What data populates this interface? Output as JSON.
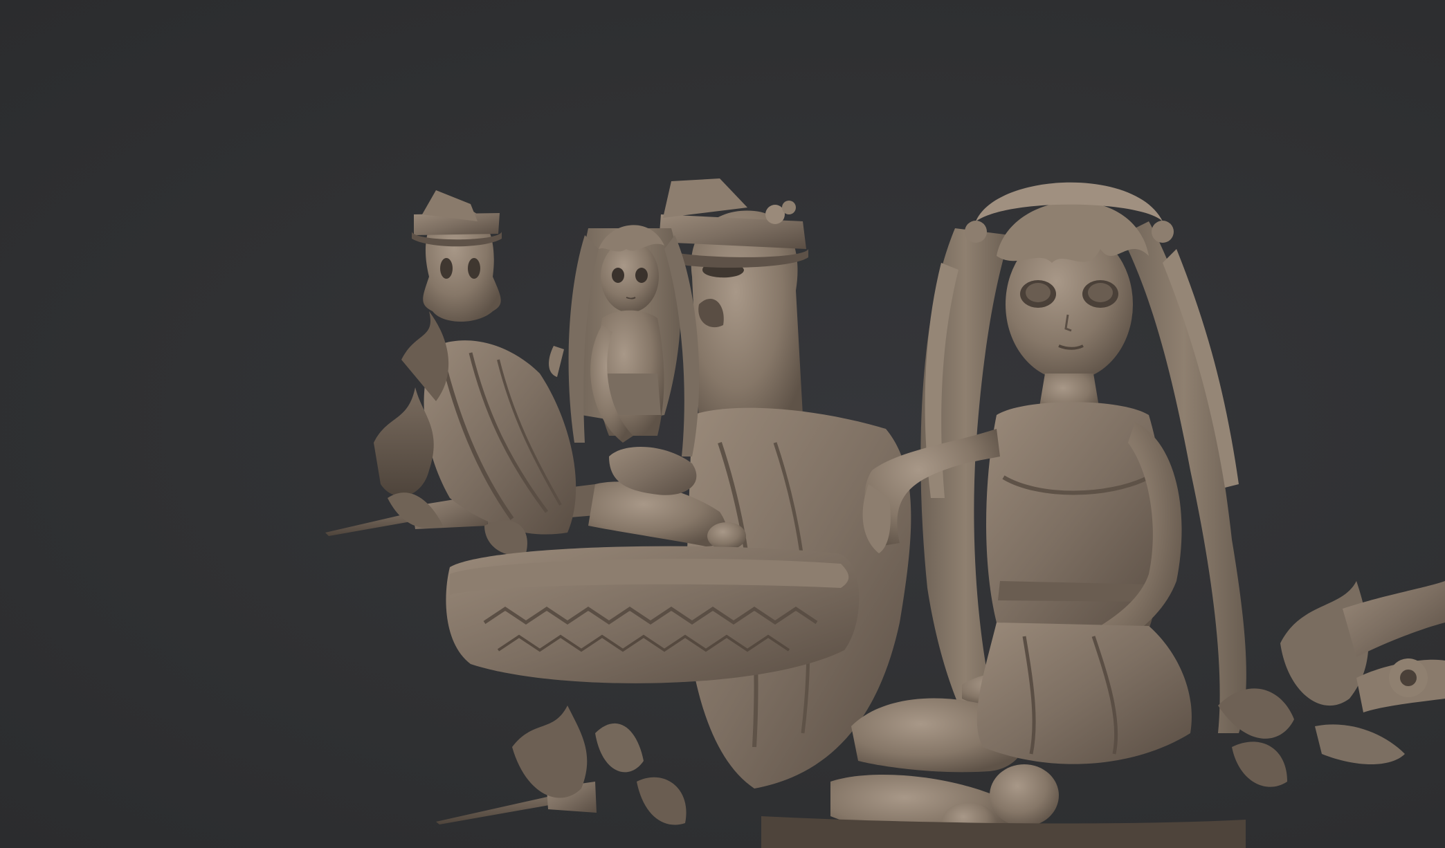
{
  "viewport": {
    "background_color": "#313234",
    "model_clay_color": "#7d6f62",
    "model_shadow_color": "#4a4038",
    "model_highlight_color": "#a39383"
  },
  "scene": {
    "subjects": [
      "seated-girl-large",
      "seated-girl-small",
      "ghost-with-hat-left",
      "ghost-with-hat-center",
      "floating-stone-slab",
      "flame-ornaments",
      "spear-staff"
    ]
  }
}
